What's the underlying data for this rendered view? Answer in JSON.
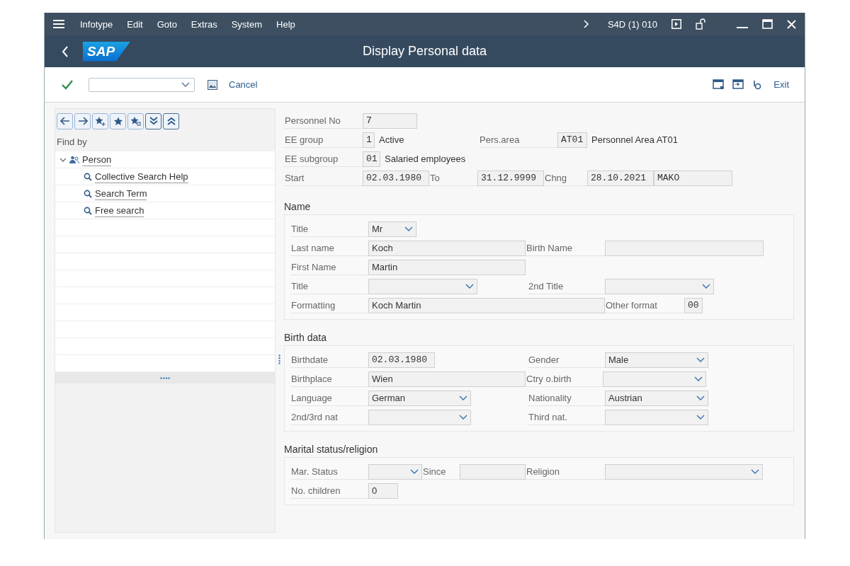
{
  "menu_bar": {
    "items": [
      "Infotype",
      "Edit",
      "Goto",
      "Extras",
      "System",
      "Help"
    ],
    "system": "S4D (1) 010"
  },
  "title_bar": {
    "logo": "SAP",
    "title": "Display Personal data"
  },
  "toolbar": {
    "cancel": "Cancel",
    "exit": "Exit"
  },
  "find_panel": {
    "heading": "Find by",
    "tree": [
      {
        "label": "Person",
        "expanded": true,
        "children": [
          {
            "label": "Collective Search Help"
          },
          {
            "label": "Search Term"
          },
          {
            "label": "Free search"
          }
        ]
      }
    ]
  },
  "form": {
    "sections": [
      {
        "rows": [
          {
            "items": [
              {
                "kind": "label",
                "text": "Personnel No"
              },
              {
                "kind": "code",
                "value": "7"
              }
            ]
          },
          {
            "items": [
              {
                "kind": "label",
                "text": "EE group"
              },
              {
                "kind": "code",
                "value": "1"
              },
              {
                "kind": "text",
                "text": "Active"
              },
              {
                "kind": "label",
                "text": "Pers.area"
              },
              {
                "kind": "code",
                "value": "AT01"
              },
              {
                "kind": "text",
                "text": "Personnel Area AT01"
              }
            ]
          },
          {
            "items": [
              {
                "kind": "label",
                "text": "EE subgroup"
              },
              {
                "kind": "code",
                "value": "01"
              },
              {
                "kind": "text",
                "text": "Salaried employees"
              }
            ]
          },
          {
            "items": [
              {
                "kind": "label",
                "text": "Start"
              },
              {
                "kind": "code",
                "value": "02.03.1980"
              },
              {
                "kind": "label",
                "text": "To"
              },
              {
                "kind": "code",
                "value": "31.12.9999"
              },
              {
                "kind": "label",
                "text": "Chng"
              },
              {
                "kind": "code",
                "value": "28.10.2021"
              },
              {
                "kind": "code",
                "value": "MAKO"
              }
            ]
          }
        ]
      },
      {
        "title": "Name",
        "rows": [
          {
            "items": [
              {
                "kind": "label",
                "text": "Title"
              },
              {
                "kind": "dropdown",
                "value": "Mr"
              }
            ]
          },
          {
            "items": [
              {
                "kind": "label",
                "text": "Last name"
              },
              {
                "kind": "field",
                "value": "Koch"
              },
              {
                "kind": "label",
                "text": "Birth Name"
              },
              {
                "kind": "field"
              }
            ]
          },
          {
            "items": [
              {
                "kind": "label",
                "text": "First Name"
              },
              {
                "kind": "field",
                "value": "Martin"
              }
            ]
          },
          {
            "items": [
              {
                "kind": "label",
                "text": "Title"
              },
              {
                "kind": "dropdown"
              },
              {
                "kind": "gap"
              },
              {
                "kind": "label",
                "text": "2nd Title"
              },
              {
                "kind": "dropdown"
              }
            ]
          },
          {
            "items": [
              {
                "kind": "label",
                "text": "Formatting"
              },
              {
                "kind": "field",
                "value": "Koch Martin"
              },
              {
                "kind": "label",
                "text": "Other format"
              },
              {
                "kind": "code",
                "value": "00"
              }
            ]
          }
        ]
      },
      {
        "title": "Birth data",
        "rows": [
          {
            "items": [
              {
                "kind": "label",
                "text": "Birthdate"
              },
              {
                "kind": "code",
                "value": "02.03.1980"
              },
              {
                "kind": "gap"
              },
              {
                "kind": "label",
                "text": "Gender"
              },
              {
                "kind": "dropdown",
                "value": "Male"
              }
            ]
          },
          {
            "items": [
              {
                "kind": "label",
                "text": "Birthplace"
              },
              {
                "kind": "field",
                "value": "Wien"
              },
              {
                "kind": "label",
                "text": "Ctry o.birth"
              },
              {
                "kind": "dropdown"
              }
            ]
          },
          {
            "items": [
              {
                "kind": "label",
                "text": "Language"
              },
              {
                "kind": "dropdown",
                "value": "German"
              },
              {
                "kind": "gap"
              },
              {
                "kind": "label",
                "text": "Nationality"
              },
              {
                "kind": "dropdown",
                "value": "Austrian"
              }
            ]
          },
          {
            "items": [
              {
                "kind": "label",
                "text": "2nd/3rd nat"
              },
              {
                "kind": "dropdown"
              },
              {
                "kind": "gap"
              },
              {
                "kind": "label",
                "text": "Third nat."
              },
              {
                "kind": "dropdown"
              }
            ]
          }
        ]
      },
      {
        "title": "Marital status/religion",
        "rows": [
          {
            "items": [
              {
                "kind": "label",
                "text": "Mar. Status"
              },
              {
                "kind": "dropdown"
              },
              {
                "kind": "label",
                "text": "Since"
              },
              {
                "kind": "field"
              },
              {
                "kind": "label",
                "text": "Religion"
              },
              {
                "kind": "dropdown"
              }
            ]
          },
          {
            "items": [
              {
                "kind": "label",
                "text": "No. children"
              },
              {
                "kind": "field",
                "value": "0"
              }
            ]
          }
        ]
      }
    ]
  }
}
